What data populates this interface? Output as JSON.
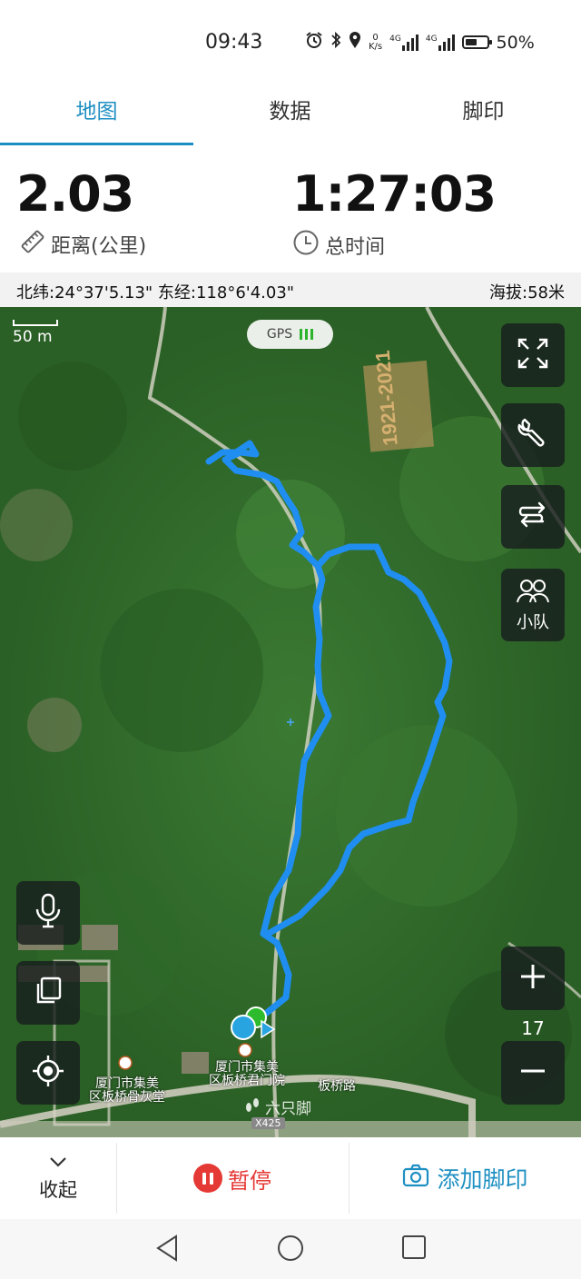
{
  "status": {
    "time": "09:43",
    "speed_value": "0",
    "speed_unit": "K/s",
    "net1": "4G",
    "net2": "4G",
    "battery": "50%"
  },
  "tabs": [
    {
      "label": "地图"
    },
    {
      "label": "数据"
    },
    {
      "label": "脚印"
    }
  ],
  "stats": {
    "distance_value": "2.03",
    "distance_label": "距离(公里)",
    "time_value": "1:27:03",
    "time_label": "总时间"
  },
  "coords": {
    "location": "北纬:24°37'5.13\" 东经:118°6'4.03\"",
    "altitude": "海拔:58米"
  },
  "map": {
    "scale_label": "50 m",
    "gps_label": "GPS",
    "zoom_level": "17",
    "squad_label": "小队",
    "poi_1_line1": "厦门市集美",
    "poi_1_line2": "区板桥骨灰堂",
    "poi_2_line1": "厦门市集美",
    "poi_2_line2": "区板桥君门院",
    "road_label": "板桥路",
    "road_code": "X425",
    "watermark": "六只脚",
    "hill_text": "1921-2021"
  },
  "bottom": {
    "collapse_label": "收起",
    "pause_label": "暂停",
    "add_label": "添加脚印"
  },
  "colors": {
    "accent": "#1e8fc2",
    "track": "#1f8ef0",
    "pause": "#e53935"
  }
}
